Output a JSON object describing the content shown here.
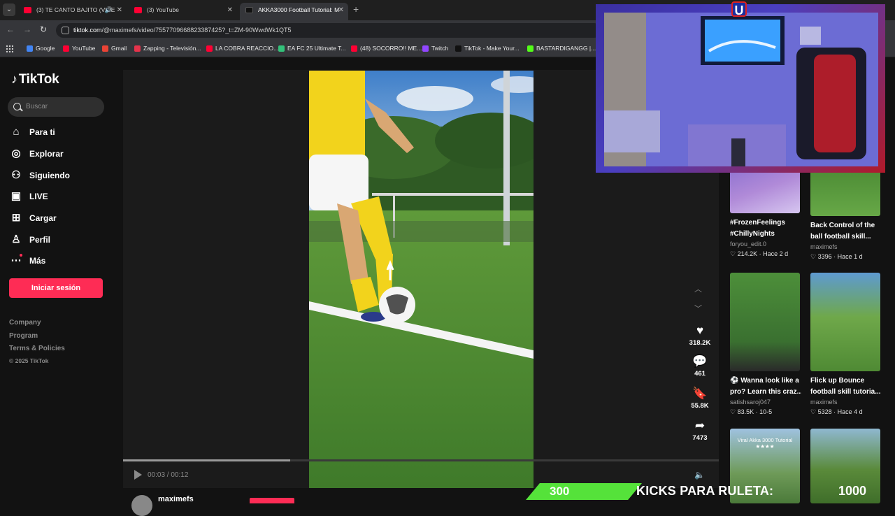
{
  "browser": {
    "tabs": [
      {
        "label": "(3) TE CANTO BAJITO (VIDE",
        "type": "youtube",
        "audio": true
      },
      {
        "label": "(3) YouTube",
        "type": "youtube",
        "audio": false
      },
      {
        "label": "AKKA3000 Football Tutorial: M",
        "type": "tiktok",
        "audio": false,
        "active": true
      }
    ],
    "url_host": "tiktok.com",
    "url_path": "/@maximefs/video/7557709668823387425?_t=ZM-90WwdWk1QT5",
    "bookmarks": [
      {
        "label": "Google",
        "color": "#4285f4"
      },
      {
        "label": "YouTube",
        "color": "#ff0033"
      },
      {
        "label": "Gmail",
        "color": "#ea4335"
      },
      {
        "label": "Zapping - Televisión...",
        "color": "#e5334b"
      },
      {
        "label": "LA COBRA REACCIO...",
        "color": "#ff0033"
      },
      {
        "label": "EA FC 25 Ultimate T...",
        "color": "#33c27a"
      },
      {
        "label": "(48) SOCORRO!! ME...",
        "color": "#ff0033"
      },
      {
        "label": "Twitch",
        "color": "#9146ff"
      },
      {
        "label": "TikTok - Make Your...",
        "color": "#111111"
      },
      {
        "label": "BASTARDIGANGG |...",
        "color": "#53fc18"
      }
    ]
  },
  "tiktok": {
    "logo": "TikTok",
    "search_placeholder": "Buscar",
    "nav": [
      {
        "label": "Para ti",
        "icon": "home-icon"
      },
      {
        "label": "Explorar",
        "icon": "compass-icon"
      },
      {
        "label": "Siguiendo",
        "icon": "following-icon"
      },
      {
        "label": "LIVE",
        "icon": "live-icon"
      },
      {
        "label": "Cargar",
        "icon": "upload-icon"
      },
      {
        "label": "Perfil",
        "icon": "profile-icon"
      },
      {
        "label": "Más",
        "icon": "more-icon"
      }
    ],
    "login_label": "Iniciar sesión",
    "footer": [
      "Company",
      "Program",
      "Terms & Policies"
    ],
    "copyright": "© 2025 TikTok",
    "player": {
      "time": "00:03 / 00:12",
      "progress": 0.28,
      "author": "maximefs"
    },
    "actions": {
      "likes": "318.2K",
      "comments": "461",
      "saves": "55.8K",
      "shares": "7473"
    },
    "recommendations": [
      {
        "title1": "#FrozenFeelings",
        "title2": "#ChillyNights",
        "author": "foryou_edit.0",
        "views": "214.2K",
        "age": "Hace 2 d"
      },
      {
        "title1": "Back Control of the",
        "title2": "ball football skill...",
        "author": "maximefs",
        "views": "3396",
        "age": "Hace 1 d"
      },
      {
        "title1": "⚽ Wanna look like a",
        "title2": "pro? Learn this craz...",
        "author": "satishsaroj047",
        "views": "83.5K",
        "age": "10-5"
      },
      {
        "title1": "Flick up Bounce",
        "title2": "football skill tutoria...",
        "author": "maximefs",
        "views": "5328",
        "age": "Hace 4 d"
      },
      {
        "overlay": "Viral Akka 3000 Tutorial ★★★★"
      }
    ]
  },
  "stream_overlay": {
    "counter_left": "300",
    "label": "KICKS PARA RULETA:",
    "counter_right": "1000",
    "crest": "U"
  }
}
